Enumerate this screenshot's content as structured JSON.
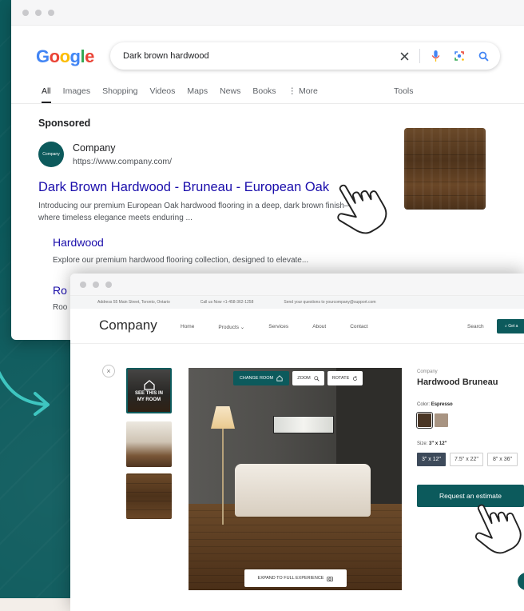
{
  "search": {
    "logo": [
      "G",
      "o",
      "o",
      "g",
      "l",
      "e"
    ],
    "query": "Dark brown hardwood",
    "tabs": [
      "All",
      "Images",
      "Shopping",
      "Videos",
      "Maps",
      "News",
      "Books",
      "⋮ More"
    ],
    "tools": "Tools",
    "sponsored": "Sponsored",
    "advertiser": {
      "logo_text": "Company",
      "name": "Company",
      "url": "https://www.company.com/"
    },
    "ad_title": "Dark Brown Hardwood - Bruneau - European Oak",
    "ad_desc": "Introducing our premium European Oak hardwood flooring in a deep, dark brown finish—where timeless elegance meets enduring ...",
    "sublink1": {
      "title": "Hardwood",
      "desc": "Explore our premium hardwood flooring collection, designed to elevate..."
    },
    "sublink2": {
      "title": "Ro",
      "desc": "Roo"
    }
  },
  "product_page": {
    "topbar": [
      "Address 55 Main Street, Toronto, Ontario",
      "Call us Now +1-458-362-1258",
      "Send your questions to yourcompany@support.com"
    ],
    "brand": "Company",
    "nav": [
      "Home",
      "Products ⌄",
      "Services",
      "About",
      "Contact"
    ],
    "search": "Search",
    "cta_top": "⌕ Get a",
    "close": "×",
    "thumb_overlay": "SEE THIS IN MY ROOM",
    "room_buttons": {
      "change": "CHANGE ROOM",
      "zoom": "ZOOM",
      "rotate": "ROTATE",
      "expand": "EXPAND TO FULL EXPERIENCE"
    },
    "product": {
      "brand": "Company",
      "title": "Hardwood Bruneau",
      "color_label": "Color:",
      "color_value": "Espresso",
      "size_label": "Size:",
      "size_value": "3\" x 12\"",
      "sizes": [
        "3\" x 12\"",
        "7.5\" x 22\"",
        "8\" x 36\""
      ],
      "cta": "Request an estimate"
    }
  },
  "colors": {
    "brand_teal": "#0c5a5c",
    "link_blue": "#1a0dab"
  }
}
